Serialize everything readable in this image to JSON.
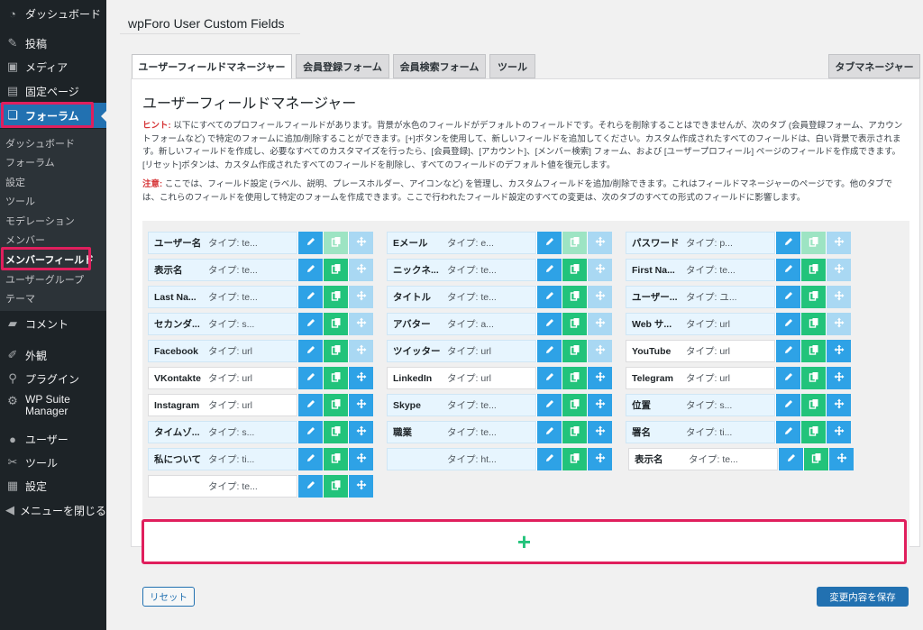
{
  "sidebar": {
    "items": [
      {
        "label": "ダッシュボード",
        "icon": "dashboard-icon"
      },
      {
        "label": "投稿",
        "icon": "pin-icon"
      },
      {
        "label": "メディア",
        "icon": "media-icon"
      },
      {
        "label": "固定ページ",
        "icon": "page-icon"
      },
      {
        "label": "フォーラム",
        "icon": "forum-icon"
      },
      {
        "label": "コメント",
        "icon": "comment-icon"
      },
      {
        "label": "外観",
        "icon": "brush-icon"
      },
      {
        "label": "プラグイン",
        "icon": "plugin-icon"
      },
      {
        "label": "WP Suite Manager",
        "icon": "gear-icon"
      },
      {
        "label": "ユーザー",
        "icon": "user-icon"
      },
      {
        "label": "ツール",
        "icon": "wrench-icon"
      },
      {
        "label": "設定",
        "icon": "settings-icon"
      },
      {
        "label": "メニューを閉じる",
        "icon": "collapse-icon"
      }
    ],
    "submenu": [
      "ダッシュボード",
      "フォーラム",
      "設定",
      "ツール",
      "モデレーション",
      "メンバー",
      "メンバーフィールド",
      "ユーザーグループ",
      "テーマ"
    ]
  },
  "page_title": "wpForo User Custom Fields",
  "tabs": [
    "ユーザーフィールドマネージャー",
    "会員登録フォーム",
    "会員検索フォーム",
    "ツール",
    "タブマネージャー"
  ],
  "heading": "ユーザーフィールドマネージャー",
  "hint": {
    "label": "ヒント:",
    "text": "以下にすべてのプロフィールフィールドがあります。背景が水色のフィールドがデフォルトのフィールドです。それらを削除することはできませんが、次のタブ (会員登録フォーム、アカウントフォームなど) で特定のフォームに追加/削除することができます。[+]ボタンを使用して、新しいフィールドを追加してください。カスタム作成されたすべてのフィールドは、白い背景で表示されます。新しいフィールドを作成し、必要なすべてのカスタマイズを行ったら、[会員登録]、[アカウント]、[メンバー検索] フォーム、および [ユーザープロフィール] ページのフィールドを作成できます。[リセット]ボタンは、カスタム作成されたすべてのフィールドを削除し、すべてのフィールドのデフォルト値を復元します。"
  },
  "note": {
    "label": "注意:",
    "text": "ここでは、フィールド設定 (ラベル、説明、プレースホルダー、アイコンなど) を管理し、カスタムフィールドを追加/削除できます。これはフィールドマネージャーのページです。他のタブでは、これらのフィールドを使用して特定のフォームを作成できます。ここで行われたフィールド設定のすべての変更は、次のタブのすべての形式のフィールドに影響します。"
  },
  "columns": [
    [
      {
        "name": "ユーザー名",
        "type": "タイプ: te...",
        "custom": false
      },
      {
        "name": "表示名",
        "type": "タイプ: te...",
        "custom": false
      },
      {
        "name": "Last Na...",
        "type": "タイプ: te...",
        "custom": false
      },
      {
        "name": "セカンダ...",
        "type": "タイプ: s...",
        "custom": false
      },
      {
        "name": "Facebook",
        "type": "タイプ: url",
        "custom": false
      },
      {
        "name": "VKontakte",
        "type": "タイプ: url",
        "custom": true
      },
      {
        "name": "Instagram",
        "type": "タイプ: url",
        "custom": true
      },
      {
        "name": "タイムゾ...",
        "type": "タイプ: s...",
        "custom": false
      },
      {
        "name": "私について",
        "type": "タイプ: ti...",
        "custom": false
      },
      {
        "name": "",
        "type": "タイプ: te...",
        "custom": true
      }
    ],
    [
      {
        "name": "Eメール",
        "type": "タイプ: e...",
        "custom": false
      },
      {
        "name": "ニックネ...",
        "type": "タイプ: te...",
        "custom": false
      },
      {
        "name": "タイトル",
        "type": "タイプ: te...",
        "custom": false
      },
      {
        "name": "アバター",
        "type": "タイプ: a...",
        "custom": false
      },
      {
        "name": "ツイッター",
        "type": "タイプ: url",
        "custom": false
      },
      {
        "name": "LinkedIn",
        "type": "タイプ: url",
        "custom": true
      },
      {
        "name": "Skype",
        "type": "タイプ: te...",
        "custom": false
      },
      {
        "name": "職業",
        "type": "タイプ: te...",
        "custom": false
      },
      {
        "name": "",
        "type": "タイプ: ht...",
        "custom": false
      }
    ],
    [
      {
        "name": "パスワード",
        "type": "タイプ: p...",
        "custom": false
      },
      {
        "name": "First Na...",
        "type": "タイプ: te...",
        "custom": false
      },
      {
        "name": "ユーザー...",
        "type": "タイプ: ユ...",
        "custom": false
      },
      {
        "name": "Web サ...",
        "type": "タイプ: url",
        "custom": false
      },
      {
        "name": "YouTube",
        "type": "タイプ: url",
        "custom": true
      },
      {
        "name": "Telegram",
        "type": "タイプ: url",
        "custom": true
      },
      {
        "name": "位置",
        "type": "タイプ: s...",
        "custom": false
      },
      {
        "name": "署名",
        "type": "タイプ: ti...",
        "custom": false
      },
      {
        "name": "表示名",
        "type": "タイプ: te...",
        "custom": true
      }
    ]
  ],
  "add_button": "+",
  "reset_label": "リセット",
  "save_label": "変更内容を保存",
  "colors": {
    "highlight": "#e01f5d",
    "accent": "#2271b1",
    "edit": "#2ea2e6",
    "copy": "#22c37b"
  }
}
